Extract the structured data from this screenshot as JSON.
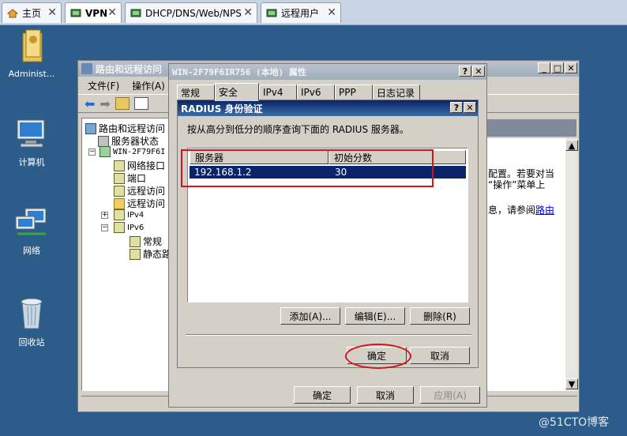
{
  "tabs": [
    {
      "label": "主页",
      "icon": "home-icon",
      "active": false
    },
    {
      "label": "VPN",
      "icon": "vm-icon",
      "active": true
    },
    {
      "label": "DHCP/DNS/Web/NPS",
      "icon": "vm-icon",
      "active": false
    },
    {
      "label": "远程用户",
      "icon": "vm-icon",
      "active": false
    }
  ],
  "desktop": {
    "icons": [
      {
        "label": "Administ...",
        "icon": "user-folder-icon"
      },
      {
        "label": "计算机",
        "icon": "computer-icon"
      },
      {
        "label": "网络",
        "icon": "network-icon"
      },
      {
        "label": "回收站",
        "icon": "recycle-bin-icon"
      }
    ]
  },
  "rras": {
    "title": "路由和远程访问",
    "menu": {
      "file": "文件(F)",
      "action": "操作(A)"
    },
    "tree": [
      {
        "label": "路由和远程访问"
      },
      {
        "label": "服务器状态"
      },
      {
        "label": "WIN-2F79F6I"
      },
      {
        "label": "网络接口"
      },
      {
        "label": "端口"
      },
      {
        "label": "远程访问"
      },
      {
        "label": "远程访问"
      },
      {
        "label": "IPv4"
      },
      {
        "label": "IPv6"
      },
      {
        "label": "常规"
      },
      {
        "label": "静态路"
      }
    ],
    "right_text": {
      "line1": "配置。若要对当",
      "line2": "“操作”菜单上",
      "line3": "息，请参阅",
      "link": "路由"
    }
  },
  "props": {
    "title": "WIN-2F79F6IR756 (本地) 属性",
    "tabs": [
      "常规",
      "安全",
      "IPv4",
      "IPv6",
      "PPP",
      "日志记录"
    ],
    "ok": "确定",
    "cancel": "取消",
    "apply": "应用(A)"
  },
  "radius": {
    "title": "RADIUS 身份验证",
    "instruction": "按从高分到低分的顺序查询下面的 RADIUS 服务器。",
    "columns": [
      "服务器",
      "初始分数"
    ],
    "rows": [
      {
        "server": "192.168.1.2",
        "score": "30"
      }
    ],
    "add": "添加(A)...",
    "edit": "编辑(E)...",
    "remove": "删除(R)",
    "ok": "确定",
    "cancel": "取消"
  },
  "watermark": "@51CTO博客",
  "colors": {
    "selection": "#0a246a",
    "highlight": "#d0161b",
    "desktop": "#2b5c8a"
  }
}
